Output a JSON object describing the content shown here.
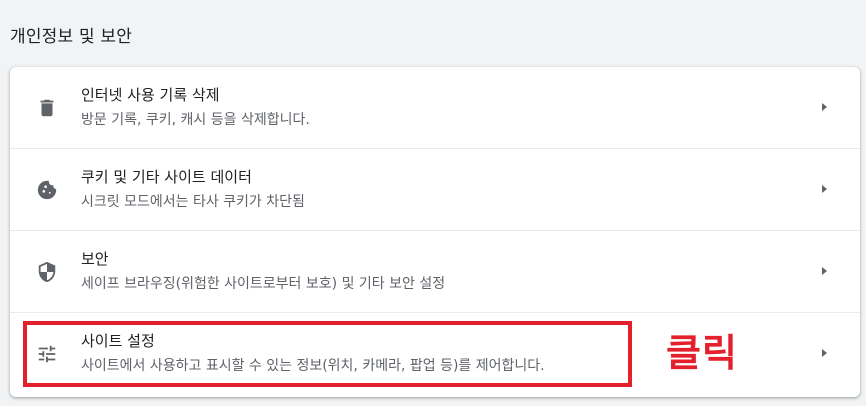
{
  "section": {
    "title": "개인정보 및 보안"
  },
  "rows": [
    {
      "title": "인터넷 사용 기록 삭제",
      "subtitle": "방문 기록, 쿠키, 캐시 등을 삭제합니다.",
      "icon": "trash-icon"
    },
    {
      "title": "쿠키 및 기타 사이트 데이터",
      "subtitle": "시크릿 모드에서는 타사 쿠키가 차단됨",
      "icon": "cookie-icon"
    },
    {
      "title": "보안",
      "subtitle": "세이프 브라우징(위험한 사이트로부터 보호) 및 기타 보안 설정",
      "icon": "shield-icon"
    },
    {
      "title": "사이트 설정",
      "subtitle": "사이트에서 사용하고 표시할 수 있는 정보(위치, 카메라, 팝업 등)를 제어합니다.",
      "icon": "tune-icon"
    }
  ],
  "annotation": {
    "label": "클릭",
    "color": "#e3202b"
  },
  "colors": {
    "background": "#f1f3f4",
    "card": "#ffffff",
    "icon": "#5f6368",
    "primary_text": "#202124",
    "secondary_text": "#5f6368"
  }
}
